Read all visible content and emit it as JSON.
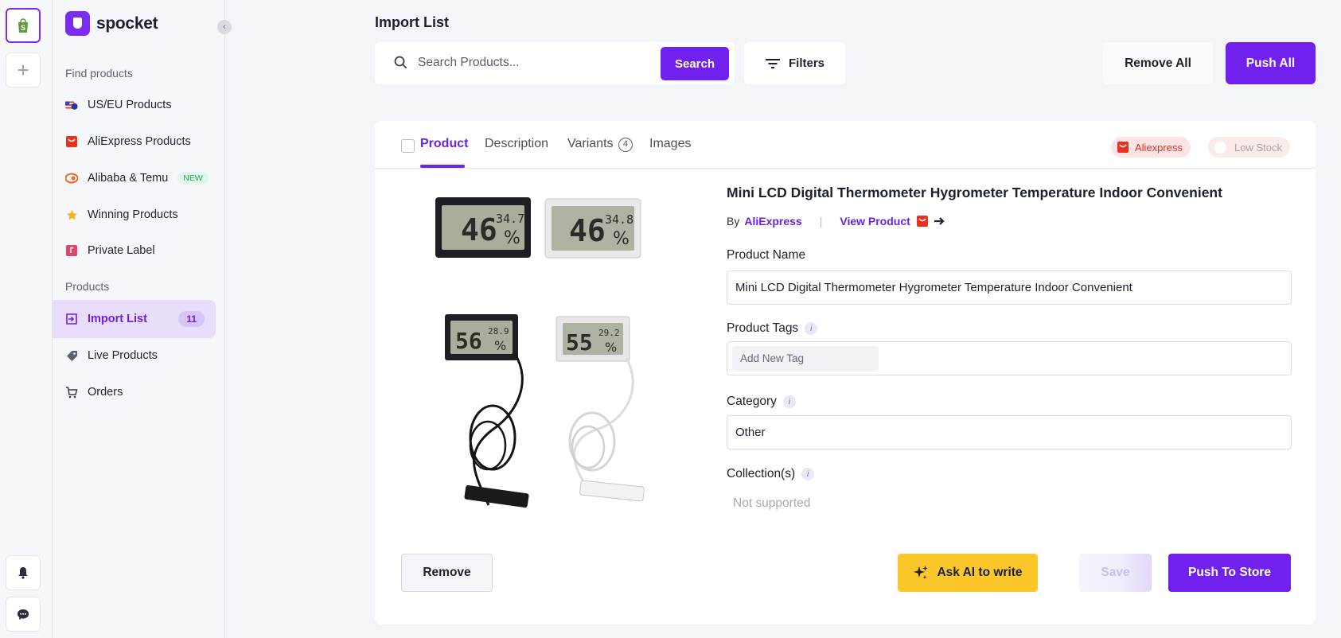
{
  "sidebar": {
    "logo_text": "spocket",
    "find_section": "Find products",
    "find_items": [
      {
        "label": "US/EU Products",
        "icon": "us-eu-flag-icon"
      },
      {
        "label": "AliExpress Products",
        "icon": "aliexpress-icon"
      },
      {
        "label": "Alibaba & Temu",
        "icon": "alibaba-icon",
        "badge": "NEW"
      },
      {
        "label": "Winning Products",
        "icon": "star-icon"
      },
      {
        "label": "Private Label",
        "icon": "private-label-icon"
      }
    ],
    "products_section": "Products",
    "product_items": [
      {
        "label": "Import List",
        "icon": "import-icon",
        "count": "11",
        "active": true
      },
      {
        "label": "Live Products",
        "icon": "tag-icon"
      },
      {
        "label": "Orders",
        "icon": "cart-icon"
      }
    ]
  },
  "header": {
    "title": "Import List",
    "search_placeholder": "Search Products...",
    "search_button": "Search",
    "filters_button": "Filters",
    "remove_all_button": "Remove All",
    "push_all_button": "Push All"
  },
  "product": {
    "tabs": {
      "product": "Product",
      "description": "Description",
      "variants": "Variants",
      "variants_count": "4",
      "images": "Images"
    },
    "source_chip": "Aliexpress",
    "stock_chip": "Low Stock",
    "title": "Mini LCD Digital Thermometer Hygrometer Temperature Indoor Convenient",
    "by_label": "By",
    "supplier": "AliExpress",
    "separator": "|",
    "view_product": "View Product",
    "name_label": "Product Name",
    "name_value": "Mini LCD Digital Thermometer Hygrometer Temperature Indoor Convenient",
    "tags_label": "Product Tags",
    "tags_placeholder": "Add New Tag",
    "category_label": "Category",
    "category_value": "Other",
    "collections_label": "Collection(s)",
    "collections_value": "Not supported",
    "image_readings": {
      "black_small": {
        "humidity": "46",
        "temp": "34.7"
      },
      "white_small": {
        "humidity": "46",
        "temp": "34.8"
      },
      "black_probe": {
        "humidity": "56",
        "temp": "28.9"
      },
      "white_probe": {
        "humidity": "55",
        "temp": "29.2"
      },
      "unit": "%"
    },
    "remove_button": "Remove",
    "ai_button": "Ask AI to write",
    "save_button": "Save",
    "push_button": "Push To Store"
  },
  "colors": {
    "accent": "#7021ee",
    "ai_yellow": "#fbc72b",
    "aliexpress_red": "#e0312a",
    "new_green": "#19a857"
  }
}
